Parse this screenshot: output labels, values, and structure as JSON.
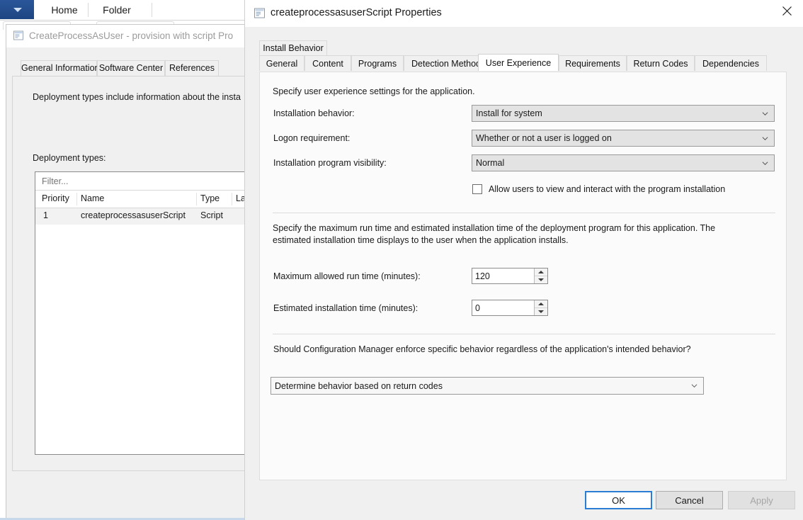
{
  "background_window": {
    "ribbon": {
      "app_button_icon": "caret-down-icon",
      "tabs": [
        {
          "label": "Home",
          "selected": true
        },
        {
          "label": "Folder",
          "selected": false
        }
      ]
    },
    "properties_window": {
      "title": "CreateProcessAsUser - provision with script Pro",
      "icon": "properties-window-icon",
      "tabs": [
        {
          "label": "General Information",
          "selected": false
        },
        {
          "label": "Software Center",
          "selected": false
        },
        {
          "label": "References",
          "selected": false
        }
      ],
      "description": "Deployment types include information about the insta",
      "section_label": "Deployment types:",
      "filter_placeholder": "Filter...",
      "columns": [
        "Priority",
        "Name",
        "Type",
        "Lar"
      ],
      "rows": [
        {
          "priority": "1",
          "name": "createprocessasuserScript",
          "type": "Script",
          "lang": ""
        }
      ]
    }
  },
  "dialog": {
    "title": "createprocessasuserScript Properties",
    "title_icon": "properties-window-icon",
    "close_icon": "close-icon",
    "tabs_row1": [
      {
        "label": "Install Behavior",
        "selected": false
      }
    ],
    "tabs_row2": [
      {
        "label": "General",
        "selected": false
      },
      {
        "label": "Content",
        "selected": false
      },
      {
        "label": "Programs",
        "selected": false
      },
      {
        "label": "Detection Method",
        "selected": false
      },
      {
        "label": "User Experience",
        "selected": true
      },
      {
        "label": "Requirements",
        "selected": false
      },
      {
        "label": "Return Codes",
        "selected": false
      },
      {
        "label": "Dependencies",
        "selected": false
      }
    ],
    "user_experience": {
      "intro": "Specify user experience settings for the application.",
      "installation_behavior": {
        "label": "Installation behavior:",
        "value": "Install for system",
        "chevron_icon": "chevron-down-icon"
      },
      "logon_requirement": {
        "label": "Logon requirement:",
        "value": "Whether or not a user is logged on",
        "chevron_icon": "chevron-down-icon"
      },
      "installation_program_visibility": {
        "label": "Installation program visibility:",
        "value": "Normal",
        "chevron_icon": "chevron-down-icon"
      },
      "allow_users_interact": {
        "label": "Allow users to view and interact with the program installation",
        "checked": false
      },
      "runtime_paragraph": "Specify the maximum run time and estimated installation time of the deployment program for this application. The estimated installation time displays to the user when the application installs.",
      "max_run_time": {
        "label": "Maximum allowed run time (minutes):",
        "value": "120"
      },
      "estimated_install_time": {
        "label": "Estimated installation time (minutes):",
        "value": "0"
      },
      "enforce_question": "Should Configuration Manager enforce specific behavior regardless of the application's intended behavior?",
      "enforce_behavior": {
        "value": "Determine behavior based on return codes",
        "chevron_icon": "chevron-down-icon"
      }
    },
    "footer": {
      "ok": "OK",
      "cancel": "Cancel",
      "apply": "Apply",
      "apply_disabled": true
    }
  },
  "colors": {
    "accent": "#2b7cd3",
    "dialog_bg": "#f0f0f0",
    "panel_bg": "#fbfbfb",
    "combo_bg": "#e3e3e3"
  }
}
